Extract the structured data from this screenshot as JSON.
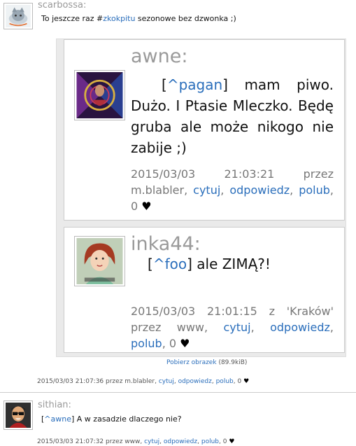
{
  "post1": {
    "username": "scarbossa:",
    "text_before": "To jeszcze raz #",
    "hashtag": "zkokpitu",
    "text_after": " sezonowe bez dzwonka ;)",
    "download_label": "Pobierz obrazek",
    "download_size": "(89.9kiB)",
    "meta": {
      "datetime": "2015/03/03 21:07:36 przez m.blabler,",
      "cytuj": "cytuj",
      "odpowiedz": "odpowiedz",
      "polub": "polub",
      "likes": ", 0",
      "heart": "♥"
    }
  },
  "embed": {
    "card1": {
      "username": "awne:",
      "mention": "^pagan",
      "text": "] mam piwo. Dużo. I Ptasie Mleczko. Będę gruba ale może nikogo nie zabije ;)",
      "meta_prefix": "2015/03/03 21:03:21 przez m.blabler,",
      "cytuj": "cytuj",
      "odpowiedz": "odpowiedz",
      "polub": "polub",
      "likes": ", 0",
      "heart": "♥"
    },
    "card2": {
      "username": "inka44:",
      "mention": "^foo",
      "text": "] ale ZIMĄ?!",
      "meta_prefix": "2015/03/03 21:01:15 z 'Kraków' przez www,",
      "cytuj": "cytuj",
      "odpowiedz": "odpowiedz",
      "polub": "polub",
      "likes": ", 0",
      "heart": "♥"
    }
  },
  "post2": {
    "username": "sithian:",
    "mention": "^awne",
    "text": "] A w zasadzie dlaczego nie?",
    "meta": {
      "datetime": "2015/03/03 21:07:32 przez www,",
      "cytuj": "cytuj",
      "odpowiedz": "odpowiedz",
      "polub": "polub",
      "likes": ", 0",
      "heart": "♥"
    }
  },
  "colors": {
    "link": "#2a6ebb",
    "username": "#999999",
    "card_bg": "#eaeaea"
  },
  "icons": [
    "avatar-scarbossa",
    "avatar-awne",
    "avatar-inka44",
    "avatar-sithian",
    "heart-icon"
  ]
}
